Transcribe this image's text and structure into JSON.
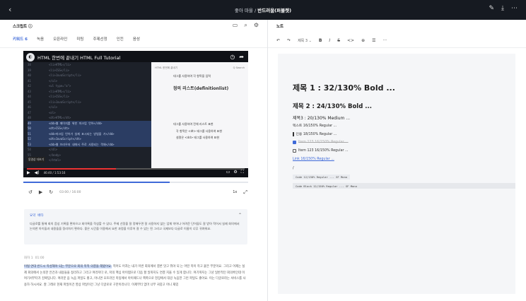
{
  "topbar": {
    "back_icon": "chevron-left-icon",
    "breadcrumb_prefix": "좋아 마을 /",
    "breadcrumb_current": "반드러움(퍼블렛)",
    "icons": [
      "edit-icon",
      "download-icon",
      "more-icon"
    ]
  },
  "left": {
    "header": "스크립트 ⓘ",
    "header_icons": [
      "document-icon",
      "search-icon",
      "settings-icon"
    ],
    "tabs": [
      "키워드 6",
      "녹음",
      "오픈라인",
      "미팅",
      "주제선정",
      "인킨",
      "음성"
    ],
    "video": {
      "title": "HTML 한번에 끝내기 HTML Full Tutorial",
      "code_lines": [
        {
          "n": "38",
          "t": "<li>HTML</li>",
          "hl": false
        },
        {
          "n": "39",
          "t": "<li>CSS</li>",
          "hl": false
        },
        {
          "n": "40",
          "t": "<li>JavaScript</li>",
          "hl": false
        },
        {
          "n": "41",
          "t": "</ul>",
          "hl": false
        },
        {
          "n": "42",
          "t": "<ul type=\"a\">",
          "hl": false
        },
        {
          "n": "43",
          "t": "<li>HTML</li>",
          "hl": false
        },
        {
          "n": "44",
          "t": "<li>CSS</li>",
          "hl": false
        },
        {
          "n": "45",
          "t": "<li>JavaScript</li>",
          "hl": false
        },
        {
          "n": "46",
          "t": "</ul>",
          "hl": false
        },
        {
          "n": "47",
          "t": "<ol>",
          "hl": false
        },
        {
          "n": "48",
          "t": "<dt>HTML</dt>",
          "hl": false
        },
        {
          "n": "49",
          "t": "<dd>웹 페이지를 위한 마크업 언어</dd>",
          "hl": true
        },
        {
          "n": "50",
          "t": "<dt>CSS</dt>",
          "hl": true
        },
        {
          "n": "51",
          "t": "<dd>마크업 언어가 실제 표시되는 방법을 기</dd>",
          "hl": true
        },
        {
          "n": "52",
          "t": "<dt>JavaScript</dt>",
          "hl": true
        },
        {
          "n": "53",
          "t": "<dd>웹 브라우저 내에서 주로 사용되는 객체</dd>",
          "hl": true
        },
        {
          "n": "54",
          "t": "</dl>",
          "hl": false
        },
        {
          "n": "55",
          "t": "</body>",
          "hl": false
        },
        {
          "n": "56",
          "t": "</html>",
          "hl": false
        }
      ],
      "slide": {
        "search": "Q Search",
        "topline": "HTML 한번에 끝내기",
        "bullet1": "대그를 사용하여 각 항목을 입력",
        "heading1": "정의 리스트(definitionlist)",
        "bullet2": "대그를 사용하여 전체 리스트 표현",
        "bullet3": "각 항목은 <dt> 태그를 사용하여 표현",
        "bullet4": "설명은 <dd> 태그를 사용하여 표현"
      },
      "badge": "동영상 더보기",
      "time": "46:40 / 1:53:16",
      "progress": 0.41
    },
    "player": {
      "time": "03:00 / 16:00",
      "speed": "1x",
      "progress": 0.65
    },
    "summary": {
      "title": "요약",
      "tag": "베타",
      "text": "다글로를 통해 회의 음성 기록을 편하으고 회이록을 작성할 수 있다. 주제 선정을 잘 정해두면 잘 사용하지 않는 업체 약어나 어려운 단어들도 잘 받아 적어서 실제 회의에서 논의한 아이들과 내용들을 정리하기 편하다. 좋은 시간을 이용해서 요한 과정을 이루어 잘 수 있는 된 그리고 국제보다 다글로 이름이 너무 귀여워요."
    },
    "transcript": {
      "speaker": "화자 1",
      "time": "01:00",
      "highlight": "이럴 연대 반드시 작성해야 되는 부분으로 회의 목적 의결을 해봤어요.",
      "text": " 적어도 어차는 내가 이번 회의에서 결론 맛고 뭐야 되 는 어떤 목이 작고 붙은 부분이요. 그리고 어제는 실제 회의에서 논의한 안건과 내용들을 정리하고 그리고 여러저다 로, 저의 핵심 아이템으로 다음 할 일까지도 연결 지을 수 있게 합니다. 여기까지는 그냥 일반적인 회의록인데 이 여기서부터가 진짜입니다. 여러분 음 녹음 파일도 좋고, 아니면 오프라인 미팅에서 아이패드나 핵폭으로 현장에서 대강 녹음한 그런 파일도 좋아요. 이는 다글로라는 서비스를 사용하 하시셔요. 잘 그래로 현재 파일이건 영상 파일이건 그냥 다글로로 구만이라니다. 이제부터 엄마 너무 귀중고 아니 재밌"
    }
  },
  "right": {
    "header": "노트",
    "toolbar": {
      "undo": "↶",
      "redo": "↷",
      "style": "제목 3",
      "bold": "B",
      "italic": "I",
      "strike": "S",
      "code": "<>",
      "link": "⊕",
      "list": "☰",
      "more": "···"
    },
    "h1": "제목 1 : 32/130% Bold ...",
    "h2": "제목 2 : 24/130% Bold ...",
    "h3": "제목3 : 20/130% Medium ...",
    "body": "텍스트 16/150% Regular ...",
    "quote": "인용 18/150% Regular ...",
    "checked": "Item 123 16/150% Regular ...",
    "unchecked": "Item 123 16/150% Regular ...",
    "link": "Link 16/150% Regular ...",
    "slash": "/",
    "code_inline": "Code 12/150% Regular ... SF Mono",
    "code_block": "Code Block 12/150% Regular ... SF Mono"
  }
}
